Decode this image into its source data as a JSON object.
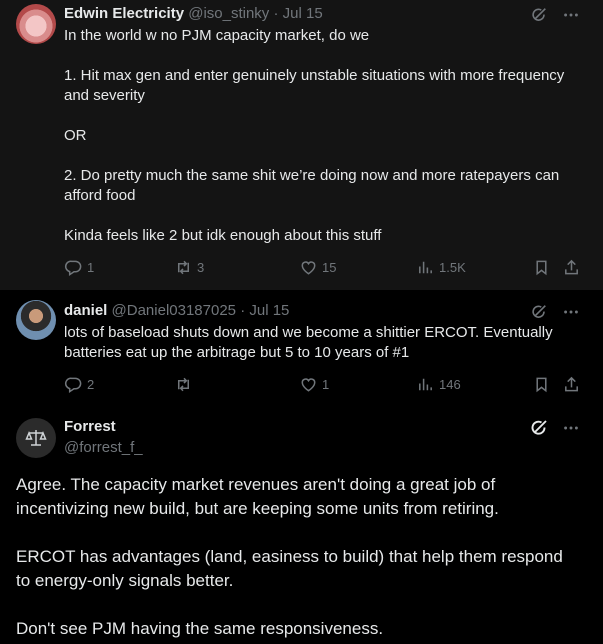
{
  "posts": [
    {
      "name": "Edwin Electricity",
      "handle": "@iso_stinky",
      "separator": " · ",
      "date": "Jul 15",
      "text": [
        "In the world w no PJM capacity market, do we",
        "1. Hit max gen and enter genuinely unstable situations with more frequency and severity",
        "OR",
        "2. Do pretty much the same shit we’re doing now and more ratepayers can afford food",
        "Kinda feels like 2 but idk enough about this stuff"
      ],
      "replies": "1",
      "reposts": "3",
      "likes": "15",
      "views": "1.5K"
    },
    {
      "name": "daniel",
      "handle": "@Daniel03187025",
      "separator": " · ",
      "date": "Jul 15",
      "text": [
        "lots of baseload shuts down and we become a shittier ERCOT. Eventually batteries eat up the arbitrage but 5 to 10 years of #1"
      ],
      "replies": "2",
      "reposts": "",
      "likes": "1",
      "views": "146"
    }
  ],
  "focus_post": {
    "name": "Forrest",
    "handle": "@forrest_f_",
    "text": [
      "Agree. The capacity market revenues aren't doing a great job of incentivizing new build, but are keeping some units from retiring.",
      "ERCOT has advantages (land, easiness to build) that help them respond to energy-only signals better.",
      "Don't see PJM having the same responsiveness."
    ]
  }
}
